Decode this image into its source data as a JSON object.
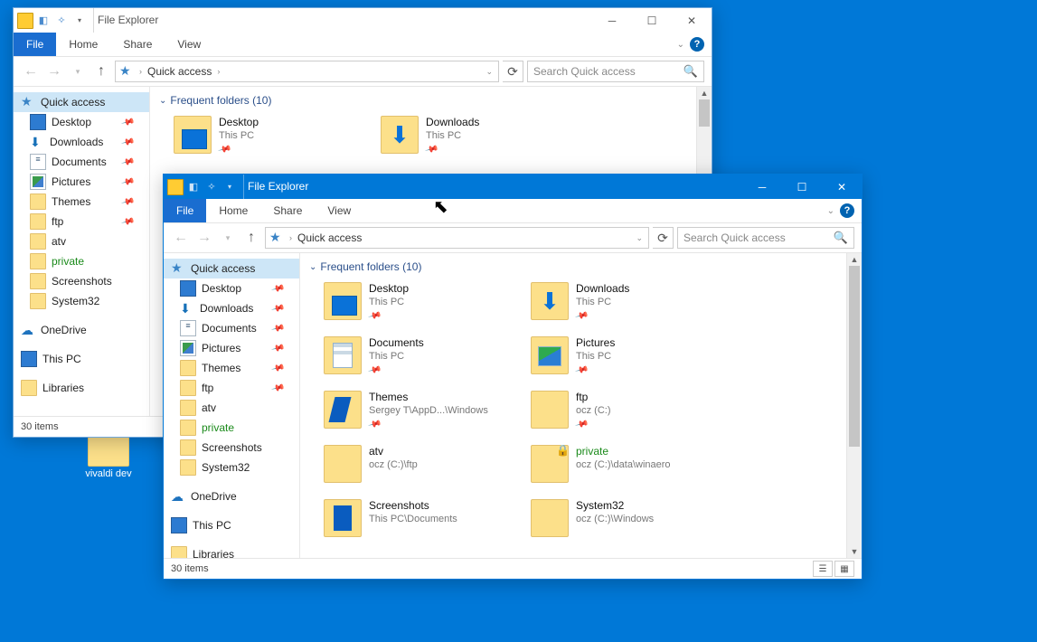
{
  "desktop": {
    "icon_label": "vivaldi dev"
  },
  "window_a": {
    "title": "File Explorer",
    "ribbon": {
      "file": "File",
      "home": "Home",
      "share": "Share",
      "view": "View"
    },
    "address": {
      "crumb": "Quick access"
    },
    "search": {
      "placeholder": "Search Quick access"
    },
    "nav": {
      "qa": "Quick access",
      "items": [
        "Desktop",
        "Downloads",
        "Documents",
        "Pictures",
        "Themes",
        "ftp",
        "atv",
        "private",
        "Screenshots",
        "System32"
      ],
      "onedrive": "OneDrive",
      "thispc": "This PC",
      "libraries": "Libraries"
    },
    "group": {
      "label": "Frequent folders (10)"
    },
    "tiles": {
      "desktop": {
        "name": "Desktop",
        "path": "This PC"
      },
      "downloads": {
        "name": "Downloads",
        "path": "This PC"
      }
    },
    "status": "30 items"
  },
  "window_b": {
    "title": "File Explorer",
    "ribbon": {
      "file": "File",
      "home": "Home",
      "share": "Share",
      "view": "View"
    },
    "address": {
      "crumb": "Quick access"
    },
    "search": {
      "placeholder": "Search Quick access"
    },
    "nav": {
      "qa": "Quick access",
      "items": [
        "Desktop",
        "Downloads",
        "Documents",
        "Pictures",
        "Themes",
        "ftp",
        "atv",
        "private",
        "Screenshots",
        "System32"
      ],
      "onedrive": "OneDrive",
      "thispc": "This PC",
      "libraries": "Libraries"
    },
    "group": {
      "label": "Frequent folders (10)"
    },
    "tiles": [
      {
        "name": "Desktop",
        "path": "This PC",
        "kind": "desk",
        "pin": true
      },
      {
        "name": "Downloads",
        "path": "This PC",
        "kind": "down",
        "pin": true
      },
      {
        "name": "Documents",
        "path": "This PC",
        "kind": "docf",
        "pin": true
      },
      {
        "name": "Pictures",
        "path": "This PC",
        "kind": "picf",
        "pin": true
      },
      {
        "name": "Themes",
        "path": "Sergey T\\AppD...\\Windows",
        "kind": "thm",
        "pin": true
      },
      {
        "name": "ftp",
        "path": "ocz (C:)",
        "kind": "plain",
        "pin": true
      },
      {
        "name": "atv",
        "path": "ocz (C:)\\ftp",
        "kind": "plain",
        "pin": false
      },
      {
        "name": "private",
        "path": "ocz (C:)\\data\\winaero",
        "kind": "plain",
        "pin": false,
        "private": true,
        "lock": true
      },
      {
        "name": "Screenshots",
        "path": "This PC\\Documents",
        "kind": "scr",
        "pin": false
      },
      {
        "name": "System32",
        "path": "ocz (C:)\\Windows",
        "kind": "plain",
        "pin": false
      }
    ],
    "status": "30 items"
  }
}
